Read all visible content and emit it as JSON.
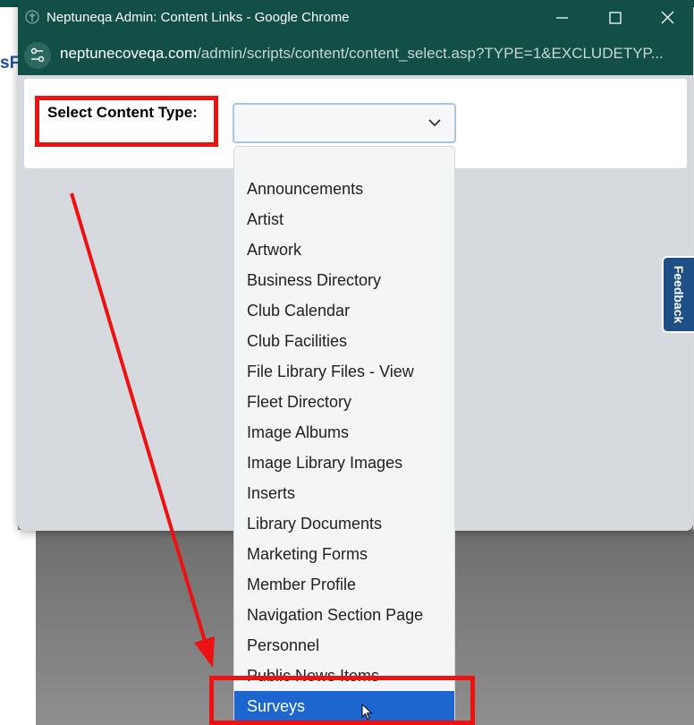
{
  "window": {
    "title": "Neptuneqa Admin: Content Links - Google Chrome",
    "url_host": "neptunecoveqa.com",
    "url_path": "/admin/scripts/content/content_select.asp?TYPE=1&EXCLUDETYP..."
  },
  "background": {
    "left_fragment": "sF"
  },
  "form": {
    "label": "Select Content Type:",
    "select_value": ""
  },
  "dropdown": {
    "options": [
      {
        "label": "Announcements"
      },
      {
        "label": "Artist"
      },
      {
        "label": "Artwork"
      },
      {
        "label": "Business Directory"
      },
      {
        "label": "Club Calendar"
      },
      {
        "label": "Club Facilities"
      },
      {
        "label": "File Library Files - View"
      },
      {
        "label": "Fleet Directory"
      },
      {
        "label": "Image Albums"
      },
      {
        "label": "Image Library Images"
      },
      {
        "label": "Inserts"
      },
      {
        "label": "Library Documents"
      },
      {
        "label": "Marketing Forms"
      },
      {
        "label": "Member Profile"
      },
      {
        "label": "Navigation Section Page"
      },
      {
        "label": "Personnel"
      },
      {
        "label": "Public News Items"
      },
      {
        "label": "Surveys"
      }
    ],
    "selected": "Surveys"
  },
  "feedback": {
    "label": "Feedback"
  },
  "colors": {
    "title_bar": "#124f47",
    "selected_option": "#1d66d0",
    "annotation": "#ee1111",
    "feedback_tab": "#1e4f86"
  }
}
